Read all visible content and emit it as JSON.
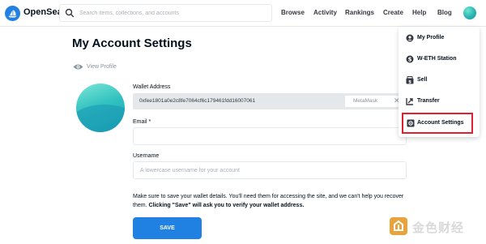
{
  "nav": {
    "brand": "OpenSea",
    "search_placeholder": "Search items, collections, and accounts",
    "links": [
      "Browse",
      "Activity",
      "Rankings",
      "Create",
      "Help",
      "Blog"
    ]
  },
  "page": {
    "title": "My Account Settings",
    "view_profile": "View Profile"
  },
  "form": {
    "wallet_label": "Wallet Address",
    "wallet_address": "0xfee1801a0e2c8fe7064cf6c179461fdd16007061",
    "wallet_provider": "MetaMask",
    "email_label": "Email *",
    "email_value": "",
    "username_label": "Username",
    "username_placeholder": "A lowercase username for your account",
    "notice_text": "Make sure to save your wallet details. You'll need them for accessing the site, and we can't help you recover them.",
    "notice_bold": "Clicking \"Save\" will ask you to verify your wallet address.",
    "save_label": "SAVE"
  },
  "menu": {
    "items": [
      {
        "label": "My Profile",
        "icon": "profile-icon"
      },
      {
        "label": "W-ETH Station",
        "icon": "weth-icon"
      },
      {
        "label": "Sell",
        "icon": "sell-icon"
      },
      {
        "label": "Transfer",
        "icon": "transfer-icon"
      },
      {
        "label": "Account Settings",
        "icon": "settings-icon"
      }
    ]
  },
  "colors": {
    "accent": "#2081e2",
    "highlight_border": "#e0202e"
  }
}
